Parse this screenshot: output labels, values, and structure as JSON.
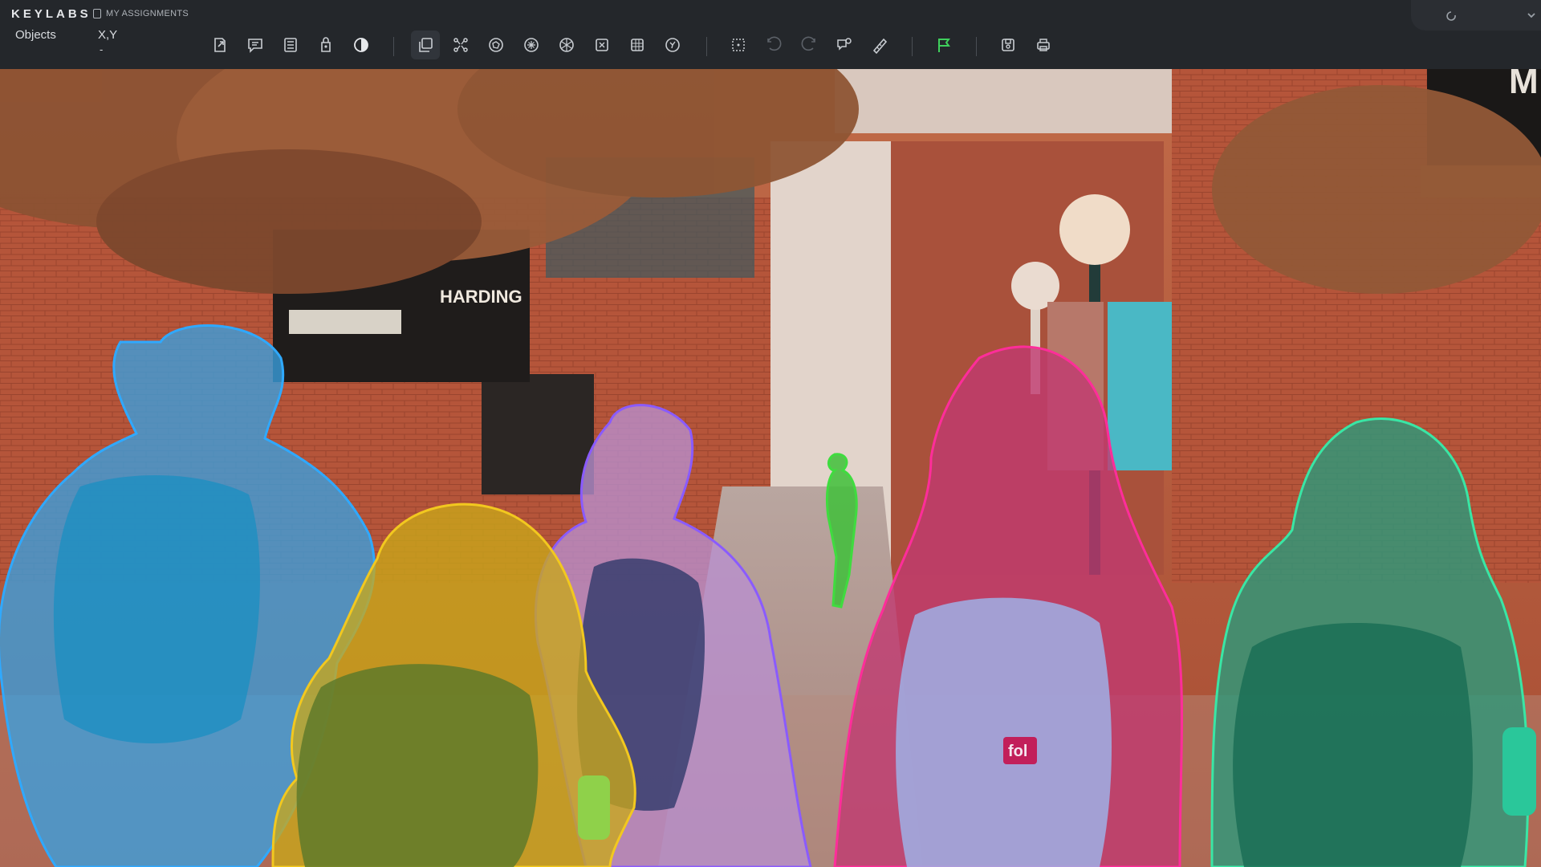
{
  "app": {
    "brand": "KEYLABS",
    "assignments_label": "MY ASSIGNMENTS",
    "objects_label": "Objects",
    "xy_label": "X,Y",
    "xy_value": "-"
  },
  "toolbar": {
    "groups": [
      [
        "export-icon",
        "comment-icon",
        "list-icon",
        "upload-icon",
        "contrast-icon"
      ],
      [
        "copy-layers-icon",
        "skeleton-icon",
        "polygon-icon",
        "brush-icon",
        "grid-icon",
        "magic-select-icon",
        "bounding-box-icon",
        "rotate-icon"
      ],
      [
        "focus-icon",
        "undo-icon",
        "redo-icon",
        "point-icon",
        "ruler-icon"
      ],
      [
        "flag-icon"
      ],
      [
        "save-icon",
        "print-icon"
      ]
    ]
  },
  "scene": {
    "sign_text": "HARDING",
    "corner_sign_text": "M",
    "patch_text": "fol"
  },
  "colors": {
    "accent_flag": "#3fd05c",
    "person_blue": "#2fa9ff",
    "person_yellow": "#f2c81f",
    "person_purple": "#8a5bff",
    "person_green_small": "#3fdc3f",
    "person_pink": "#ff2d9a",
    "person_teal": "#39e6a5"
  }
}
